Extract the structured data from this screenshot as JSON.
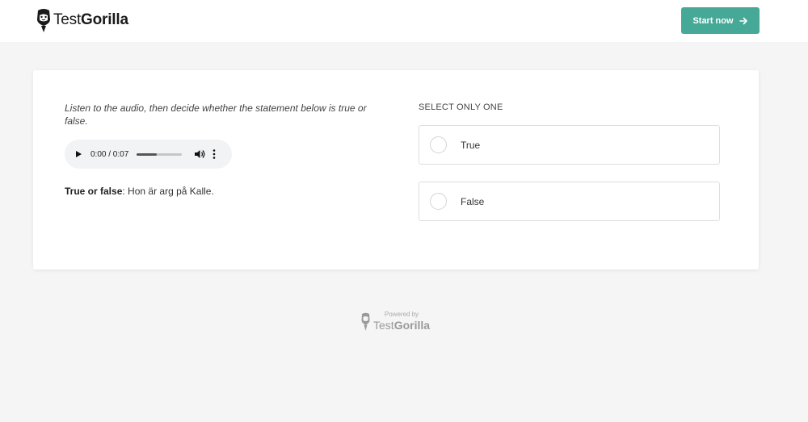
{
  "header": {
    "brand_regular": "Test",
    "brand_bold": "Gorilla",
    "start_button_label": "Start now",
    "accent_color": "#46a997"
  },
  "question": {
    "instruction": "Listen to the audio, then decide whether the statement below is true or false.",
    "audio": {
      "time_display": "0:00 / 0:07",
      "progress_fraction": 0.0
    },
    "statement_label": "True or false",
    "statement_separator": ":",
    "statement_text": " Hon är arg på Kalle."
  },
  "answers": {
    "select_label": "SELECT ONLY ONE",
    "options": [
      {
        "label": "True"
      },
      {
        "label": "False"
      }
    ]
  },
  "footer": {
    "powered_by": "Powered by",
    "brand_regular": "Test",
    "brand_bold": "Gorilla"
  }
}
